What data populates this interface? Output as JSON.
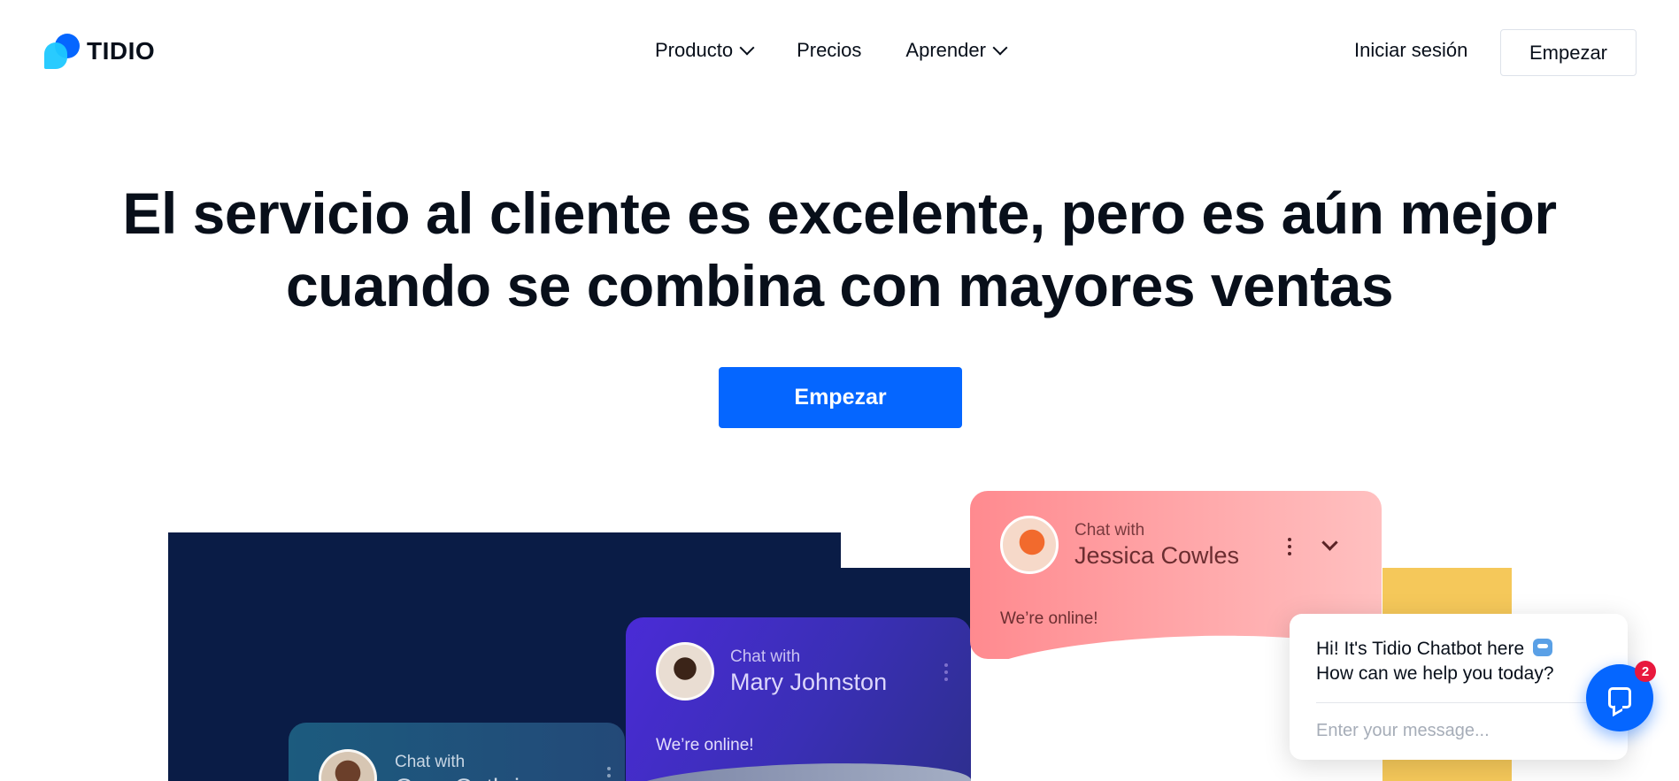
{
  "header": {
    "logo_text": "TIDIO",
    "nav": [
      {
        "label": "Producto",
        "has_dropdown": true
      },
      {
        "label": "Precios",
        "has_dropdown": false
      },
      {
        "label": "Aprender",
        "has_dropdown": true
      }
    ],
    "login_label": "Iniciar sesión",
    "start_label": "Empezar"
  },
  "hero": {
    "title_normal_1": "El servicio al cliente es excelente, pero es ",
    "title_bold": "aún mejor",
    "title_normal_2": "cuando se combina con mayores ventas",
    "cta_label": "Empezar"
  },
  "cards": {
    "teal": {
      "chat_with": "Chat with",
      "name": "Greg Guthrie"
    },
    "purple": {
      "chat_with": "Chat with",
      "name": "Mary Johnston",
      "status": "We’re online!"
    },
    "pink": {
      "chat_with": "Chat with",
      "name": "Jessica Cowles",
      "status": "We’re online!"
    }
  },
  "chat_widget": {
    "message_line1": "Hi! It's Tidio Chatbot here",
    "message_line2": "How can we help you today?",
    "input_placeholder": "Enter your message...",
    "badge_count": "2"
  },
  "colors": {
    "brand_blue": "#0566ff",
    "dark_navy": "#0a1c46",
    "pink": "#ff8a8f",
    "yellow": "#f5c85a",
    "badge_red": "#e8183d"
  },
  "icons": [
    "tidio-logo-icon",
    "chevron-down-icon",
    "more-vertical-icon",
    "robot-icon",
    "chat-bubble-icon"
  ]
}
